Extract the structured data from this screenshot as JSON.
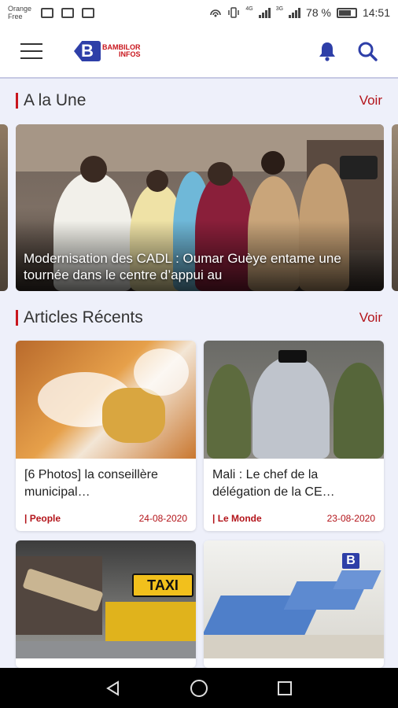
{
  "status_bar": {
    "carrier_line1": "Orange",
    "carrier_line2": "Free",
    "battery_percent": "78 %",
    "time": "14:51",
    "net_label_1": "4G",
    "net_label_2": "3G"
  },
  "app_bar": {
    "logo_text_top": "BAMBILOR",
    "logo_text_bottom": "INFOS",
    "logo_letter": "B"
  },
  "sections": {
    "une": {
      "title": "A la Une",
      "more_label": "Voir"
    },
    "recent": {
      "title": "Articles Récents",
      "more_label": "Voir"
    }
  },
  "featured": {
    "caption": "Modernisation des CADL : Oumar Guèye entame une tournée dans le centre d’appui au"
  },
  "articles": [
    {
      "title": "[6 Photos] la conseillère municipal…",
      "category": "| People",
      "date": "24-08-2020"
    },
    {
      "title": "Mali : Le chef de la délégation de la CE…",
      "category": "| Le Monde",
      "date": "23-08-2020"
    },
    {
      "title": "",
      "category": "",
      "date": ""
    },
    {
      "title": "",
      "category": "",
      "date": ""
    }
  ],
  "thumbnail_text": {
    "taxi_sign": "TAXI",
    "logo_overlay": "B"
  },
  "colors": {
    "accent_red": "#c8161d",
    "brand_blue": "#2e3fa8",
    "background": "#eef0fa"
  },
  "icons": {
    "menu": "hamburger-icon",
    "notifications": "bell-icon",
    "search": "search-icon",
    "back": "back-triangle-icon",
    "home": "home-circle-icon",
    "recents": "recents-square-icon"
  }
}
